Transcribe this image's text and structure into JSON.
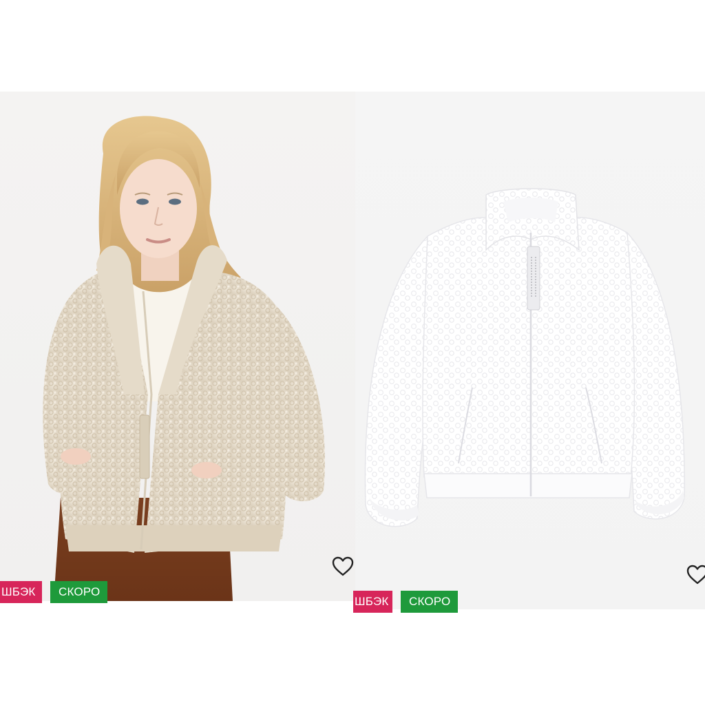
{
  "colors": {
    "cashback_badge": "#d7255a",
    "soon_badge": "#1e9a3b",
    "background": "#ffffff",
    "card_background": "#f3f3f2"
  },
  "products": [
    {
      "image": "girl-in-beige-sherpa-jacket",
      "favorite_icon": "heart-outline-icon",
      "badges": {
        "cashback": "ШБЭК",
        "soon": "СКОРО"
      }
    },
    {
      "image": "white-sherpa-jacket",
      "favorite_icon": "heart-outline-icon",
      "badges": {
        "cashback": "ШБЭК",
        "soon": "СКОРО"
      }
    }
  ]
}
